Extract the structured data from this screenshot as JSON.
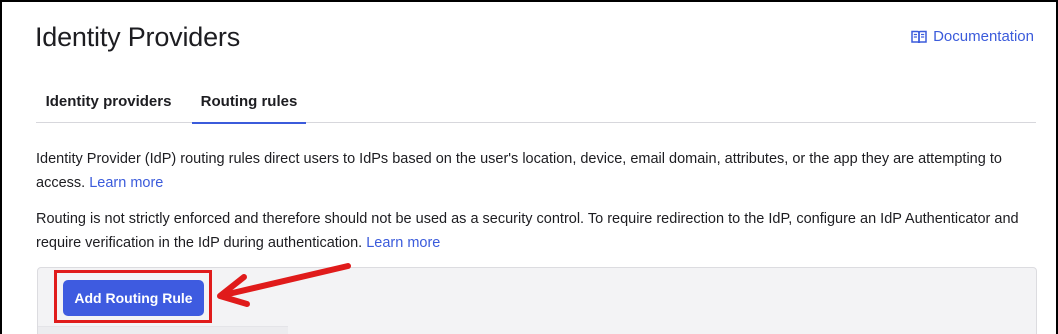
{
  "header": {
    "title": "Identity Providers",
    "documentation_label": "Documentation",
    "documentation_icon": "book-icon"
  },
  "tabs": [
    {
      "label": "Identity providers",
      "active": false
    },
    {
      "label": "Routing rules",
      "active": true
    }
  ],
  "content": {
    "paragraph1": "Identity Provider (IdP) routing rules direct users to IdPs based on the user's location, device, email domain, attributes, or the app they are attempting to access.",
    "paragraph1_link": "Learn more",
    "paragraph2": "Routing is not strictly enforced and therefore should not be used as a security control. To require redirection to the IdP, configure an IdP Authenticator and require verification in the IdP during authentication.",
    "paragraph2_link": "Learn more"
  },
  "actions": {
    "add_routing_rule_label": "Add Routing Rule"
  },
  "colors": {
    "accent": "#3e5be0",
    "link": "#3b5bdb",
    "annotation": "#e01b1b"
  }
}
